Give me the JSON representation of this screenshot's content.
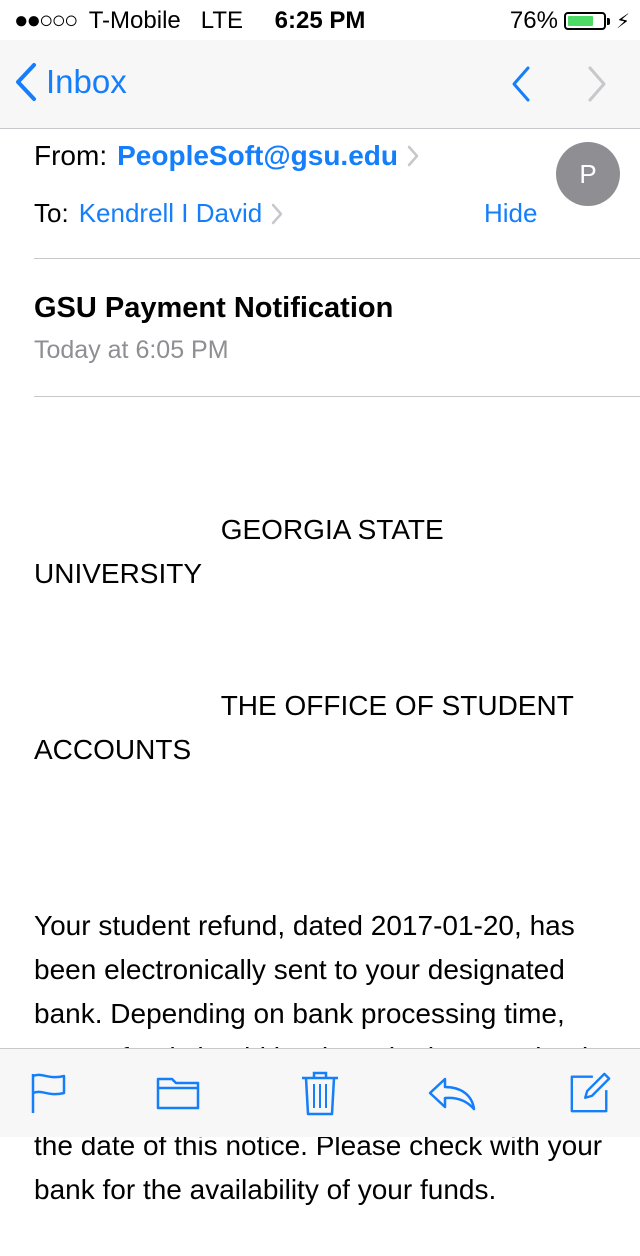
{
  "status_bar": {
    "signal": "●●○○○",
    "carrier": "T-Mobile",
    "network": "LTE",
    "time": "6:25 PM",
    "battery_percent": "76%",
    "battery_level": 0.76
  },
  "nav": {
    "back_label": "Inbox",
    "prev_icon": "chevron-up-icon",
    "next_icon": "chevron-down-icon"
  },
  "header": {
    "from_label": "From:",
    "sender": "PeopleSoft@gsu.edu",
    "to_label": "To:",
    "recipient": "Kendrell I David",
    "hide_label": "Hide",
    "avatar_initial": "P"
  },
  "message": {
    "subject": "GSU Payment Notification",
    "date": "Today at 6:05 PM",
    "heading_line1": "                        GEORGIA STATE UNIVERSITY",
    "heading_line2": "                        THE OFFICE OF STUDENT ACCOUNTS",
    "paragraph1": "Your student refund, dated 2017-01-20, has been electronically sent to your designated bank. Depending on bank processing time, your refund should be deposited to your bank account within THREE BUSINESS DAYS of the date of this notice. Please check with your bank for the availability of your funds."
  },
  "toolbar": {
    "flag_icon": "flag-icon",
    "folder_icon": "folder-icon",
    "trash_icon": "trash-icon",
    "reply_icon": "reply-icon",
    "compose_icon": "compose-icon"
  },
  "colors": {
    "accent": "#147efb",
    "battery": "#4cd964",
    "muted": "#8e8e93"
  }
}
